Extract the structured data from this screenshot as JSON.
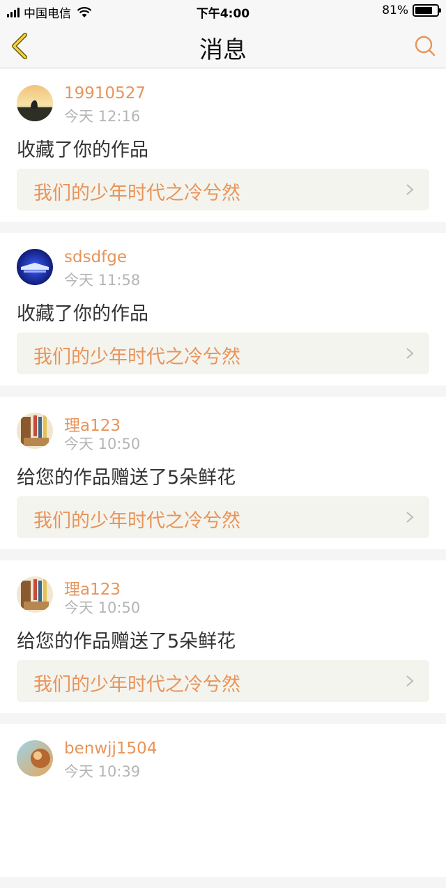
{
  "status_bar": {
    "carrier": "中国电信",
    "time": "下午4:00",
    "battery": "81%",
    "battery_level": 0.81
  },
  "nav": {
    "title": "消息",
    "back_icon": "chevron-left-icon",
    "search_icon": "search-icon",
    "accent": "#e8945a"
  },
  "messages": [
    {
      "username": "19910527",
      "time": "今天 12:16",
      "text": "收藏了你的作品",
      "work_title": "我们的少年时代之冷兮然",
      "avatar": "sunset"
    },
    {
      "username": "sdsdfge",
      "time": "今天 11:58",
      "text": "收藏了你的作品",
      "work_title": "我们的少年时代之冷兮然",
      "avatar": "night"
    },
    {
      "username": "理a123",
      "time": "今天 10:50",
      "text": "给您的作品赠送了5朵鲜花",
      "work_title": "我们的少年时代之冷兮然",
      "avatar": "room"
    },
    {
      "username": "理a123",
      "time": "今天 10:50",
      "text": "给您的作品赠送了5朵鲜花",
      "work_title": "我们的少年时代之冷兮然",
      "avatar": "room"
    },
    {
      "username": "benwjj1504",
      "time": "今天 10:39",
      "text": "",
      "work_title": "",
      "avatar": "warm"
    }
  ]
}
